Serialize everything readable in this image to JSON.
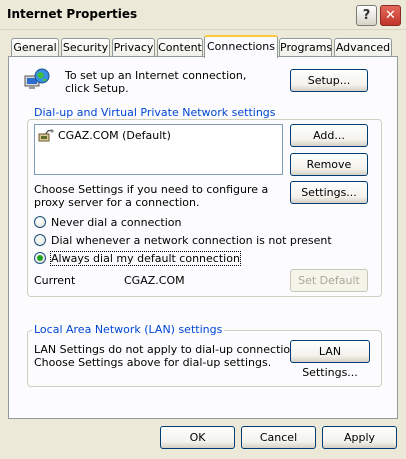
{
  "window": {
    "title": "Internet Properties"
  },
  "tabs": [
    {
      "label": "General"
    },
    {
      "label": "Security"
    },
    {
      "label": "Privacy"
    },
    {
      "label": "Content"
    },
    {
      "label": "Connections",
      "active": true
    },
    {
      "label": "Programs"
    },
    {
      "label": "Advanced"
    }
  ],
  "setup": {
    "text": "To set up an Internet connection, click Setup.",
    "button": "Setup..."
  },
  "dialup": {
    "group_label": "Dial-up and Virtual Private Network settings",
    "connections": [
      {
        "name": "CGAZ.COM (Default)"
      }
    ],
    "add_button": "Add...",
    "remove_button": "Remove",
    "settings_button": "Settings...",
    "proxy_text": "Choose Settings if you need to configure a proxy server for a connection.",
    "options": [
      {
        "label": "Never dial a connection",
        "selected": false
      },
      {
        "label": "Dial whenever a network connection is not present",
        "selected": false
      },
      {
        "label": "Always dial my default connection",
        "selected": true
      }
    ],
    "current_label": "Current",
    "current_value": "CGAZ.COM",
    "set_default_button": "Set Default"
  },
  "lan": {
    "group_label": "Local Area Network (LAN) settings",
    "text_line1": "LAN Settings do not apply to dial-up connections.",
    "text_line2": "Choose Settings above for dial-up settings.",
    "button": "LAN Settings..."
  },
  "footer": {
    "ok": "OK",
    "cancel": "Cancel",
    "apply": "Apply"
  },
  "icons": {
    "help": "help-icon",
    "close": "close-icon",
    "globe": "globe-computer-icon",
    "connection": "dialup-connection-icon"
  }
}
